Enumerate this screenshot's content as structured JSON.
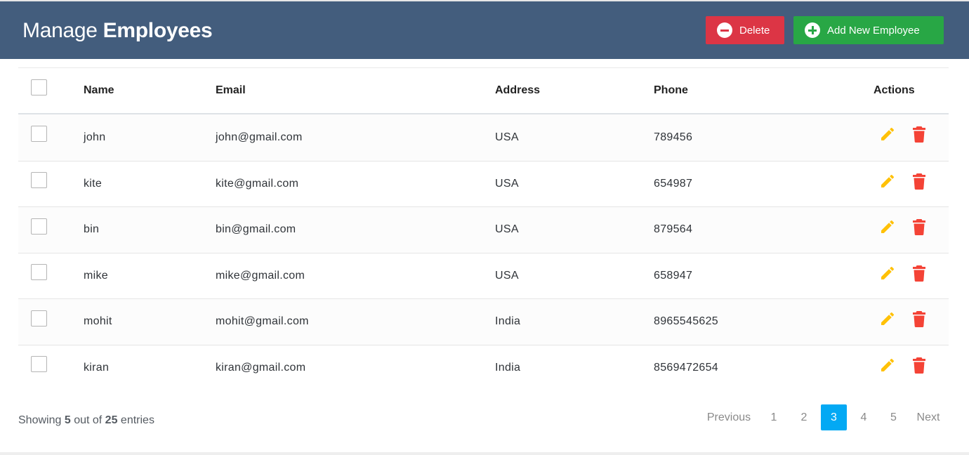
{
  "header": {
    "title_light": "Manage",
    "title_bold": "Employees",
    "delete_label": "Delete",
    "add_label": "Add New Employee",
    "bg_color": "#435d7d",
    "delete_color": "#dc3545",
    "add_color": "#28a745"
  },
  "table": {
    "columns": {
      "name": "Name",
      "email": "Email",
      "address": "Address",
      "phone": "Phone",
      "actions": "Actions"
    },
    "rows": [
      {
        "name": "john",
        "email": "john@gmail.com",
        "address": "USA",
        "phone": "789456"
      },
      {
        "name": "kite",
        "email": "kite@gmail.com",
        "address": "USA",
        "phone": "654987"
      },
      {
        "name": "bin",
        "email": "bin@gmail.com",
        "address": "USA",
        "phone": "879564"
      },
      {
        "name": "mike",
        "email": "mike@gmail.com",
        "address": "USA",
        "phone": "658947"
      },
      {
        "name": "mohit",
        "email": "mohit@gmail.com",
        "address": "India",
        "phone": "8965545625"
      },
      {
        "name": "kiran",
        "email": "kiran@gmail.com",
        "address": "India",
        "phone": "8569472654"
      }
    ],
    "action_icons": [
      "pencil-icon",
      "trash-icon"
    ],
    "edit_color": "#ffc107",
    "delete_color": "#f44336"
  },
  "footer": {
    "showing_prefix": "Showing",
    "shown_count": "5",
    "out_of": "out of",
    "total_count": "25",
    "entries": "entries"
  },
  "pagination": {
    "previous": "Previous",
    "pages": [
      "1",
      "2",
      "3",
      "4",
      "5"
    ],
    "active_page": "3",
    "next": "Next",
    "active_color": "#03a9f4"
  }
}
